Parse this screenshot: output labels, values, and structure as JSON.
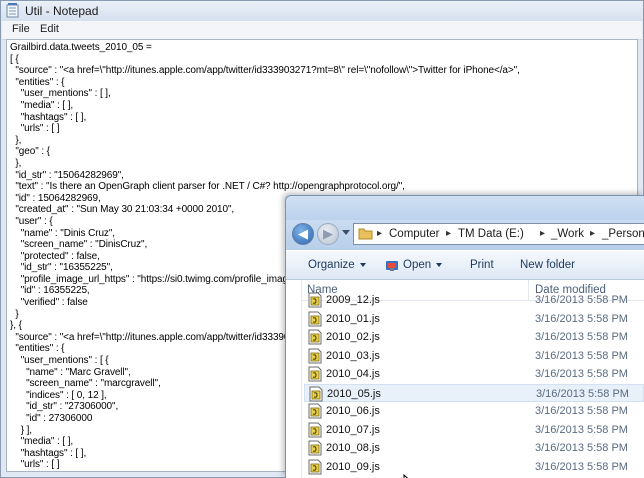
{
  "notepad": {
    "title": "Util - Notepad",
    "menu": [
      "File",
      "Edit"
    ],
    "lines": [
      "Grailbird.data.tweets_2010_05 =",
      "[ {",
      "  \"source\" : \"<a href=\\\"http://itunes.apple.com/app/twitter/id333903271?mt=8\\\" rel=\\\"nofollow\\\">Twitter for iPhone</a>\",",
      "  \"entities\" : {",
      "    \"user_mentions\" : [ ],",
      "    \"media\" : [ ],",
      "    \"hashtags\" : [ ],",
      "    \"urls\" : [ ]",
      "  },",
      "  \"geo\" : {",
      "  },",
      "  \"id_str\" : \"15064282969\",",
      "  \"text\" : \"Is there an OpenGraph client parser for .NET / C#? http://opengraphprotocol.org/\",",
      "  \"id\" : 15064282969,",
      "  \"created_at\" : \"Sun May 30 21:03:34 +0000 2010\",",
      "  \"user\" : {",
      "    \"name\" : \"Dinis Cruz\",",
      "    \"screen_name\" : \"DinisCruz\",",
      "    \"protected\" : false,",
      "    \"id_str\" : \"16355225\",",
      "    \"profile_image_url_https\" : \"https://si0.twimg.com/profile_images",
      "    \"id\" : 16355225,",
      "    \"verified\" : false",
      "  }",
      "}, {",
      "  \"source\" : \"<a href=\\\"http://itunes.apple.com/app/twitter/id33390",
      "  \"entities\" : {",
      "    \"user_mentions\" : [ {",
      "      \"name\" : \"Marc Gravell\",",
      "      \"screen_name\" : \"marcgravell\",",
      "      \"indices\" : [ 0, 12 ],",
      "      \"id_str\" : \"27306000\",",
      "      \"id\" : 27306000",
      "    } ],",
      "    \"media\" : [ ],",
      "    \"hashtags\" : [ ],",
      "    \"urls\" : [ ]"
    ]
  },
  "explorer": {
    "breadcrumbs": [
      "Computer",
      "TM Data (E:)",
      "_Work",
      "_Personal"
    ],
    "toolbar": {
      "organize": "Organize",
      "open": "Open",
      "print": "Print",
      "new_folder": "New folder"
    },
    "columns": {
      "name": "Name",
      "date": "Date modified"
    },
    "files": [
      {
        "name": "2009_12.js",
        "date": "3/16/2013 5:58 PM"
      },
      {
        "name": "2010_01.js",
        "date": "3/16/2013 5:58 PM"
      },
      {
        "name": "2010_02.js",
        "date": "3/16/2013 5:58 PM"
      },
      {
        "name": "2010_03.js",
        "date": "3/16/2013 5:58 PM"
      },
      {
        "name": "2010_04.js",
        "date": "3/16/2013 5:58 PM"
      },
      {
        "name": "2010_05.js",
        "date": "3/16/2013 5:58 PM"
      },
      {
        "name": "2010_06.js",
        "date": "3/16/2013 5:58 PM"
      },
      {
        "name": "2010_07.js",
        "date": "3/16/2013 5:58 PM"
      },
      {
        "name": "2010_08.js",
        "date": "3/16/2013 5:58 PM"
      },
      {
        "name": "2010_09.js",
        "date": "3/16/2013 5:58 PM"
      }
    ],
    "selected_file": "2010_05.js"
  }
}
